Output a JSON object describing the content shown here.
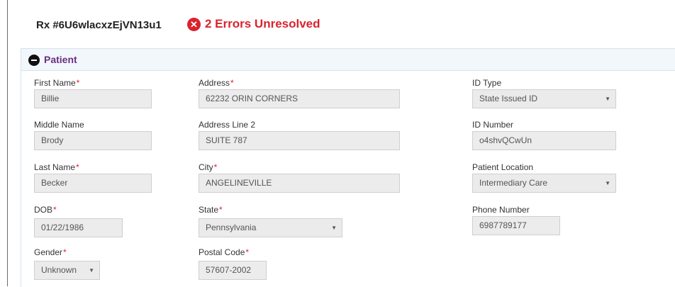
{
  "header": {
    "rx_id": "Rx #6U6wlacxzEjVN13u1",
    "errors_text": "2 Errors Unresolved",
    "error_icon": "x-circle-icon"
  },
  "section": {
    "title": "Patient",
    "icon": "minus-circle-icon"
  },
  "required_marker": "*",
  "fields": {
    "first_name": {
      "label": "First Name",
      "value": "Billie"
    },
    "middle_name": {
      "label": "Middle Name",
      "value": "Brody"
    },
    "last_name": {
      "label": "Last Name",
      "value": "Becker"
    },
    "dob": {
      "label": "DOB",
      "value": "01/22/1986"
    },
    "gender": {
      "label": "Gender",
      "value": "Unknown"
    },
    "address": {
      "label": "Address",
      "value": "62232 ORIN CORNERS"
    },
    "address2": {
      "label": "Address Line 2",
      "value": "SUITE 787"
    },
    "city": {
      "label": "City",
      "value": "ANGELINEVILLE"
    },
    "state": {
      "label": "State",
      "value": "Pennsylvania"
    },
    "postal": {
      "label": "Postal Code",
      "value": "57607-2002"
    },
    "id_type": {
      "label": "ID Type",
      "value": "State Issued ID"
    },
    "id_number": {
      "label": "ID Number",
      "value": "o4shvQCwUn"
    },
    "location": {
      "label": "Patient Location",
      "value": "Intermediary Care"
    },
    "phone": {
      "label": "Phone Number",
      "value": "6987789177"
    }
  },
  "colors": {
    "error": "#d9232e",
    "section_title": "#6b2f83",
    "header_bg": "#f2f7fb"
  }
}
